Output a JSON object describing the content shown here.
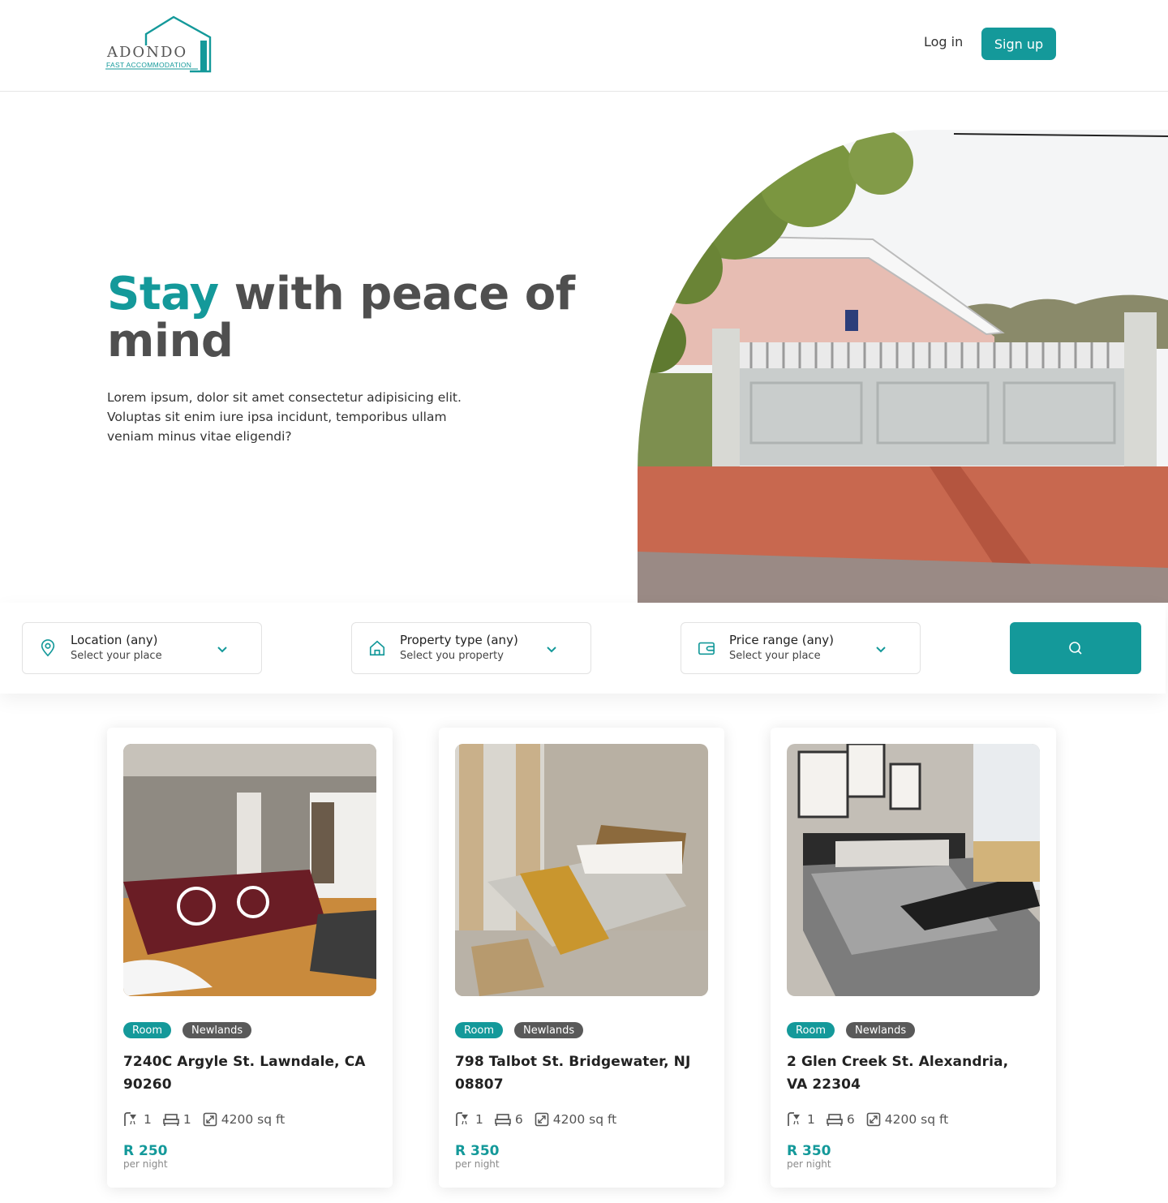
{
  "brand": {
    "name": "ADONDO",
    "tagline": "FAST ACCOMMODATION",
    "accent": "#14999a"
  },
  "nav": {
    "login": "Log in",
    "signup": "Sign up"
  },
  "hero": {
    "title_accent": "Stay",
    "title_rest": " with peace of mind",
    "body": "Lorem ipsum, dolor sit amet consectetur adipisicing elit. Voluptas sit enim iure ipsa incidunt, temporibus ullam veniam minus vitae eligendi?"
  },
  "search": {
    "fields": [
      {
        "icon": "location-pin-icon",
        "label": "Location (any)",
        "sub": "Select your place"
      },
      {
        "icon": "house-icon",
        "label": "Property type (any)",
        "sub": "Select you property"
      },
      {
        "icon": "wallet-icon",
        "label": "Price range (any)",
        "sub": "Select your place"
      }
    ],
    "button_icon": "search-icon"
  },
  "listings": [
    {
      "tag_type": "Room",
      "tag_area": "Newlands",
      "address": "7240C Argyle St. Lawndale, CA 90260",
      "baths": "1",
      "beds": "1",
      "size": "4200 sq ft",
      "price": "R 250",
      "per": "per night"
    },
    {
      "tag_type": "Room",
      "tag_area": "Newlands",
      "address": "798 Talbot St. Bridgewater, NJ 08807",
      "baths": "1",
      "beds": "6",
      "size": "4200 sq ft",
      "price": "R 350",
      "per": "per night"
    },
    {
      "tag_type": "Room",
      "tag_area": "Newlands",
      "address": "2 Glen Creek St. Alexandria, VA 22304",
      "baths": "1",
      "beds": "6",
      "size": "4200 sq ft",
      "price": "R 350",
      "per": "per night"
    }
  ]
}
